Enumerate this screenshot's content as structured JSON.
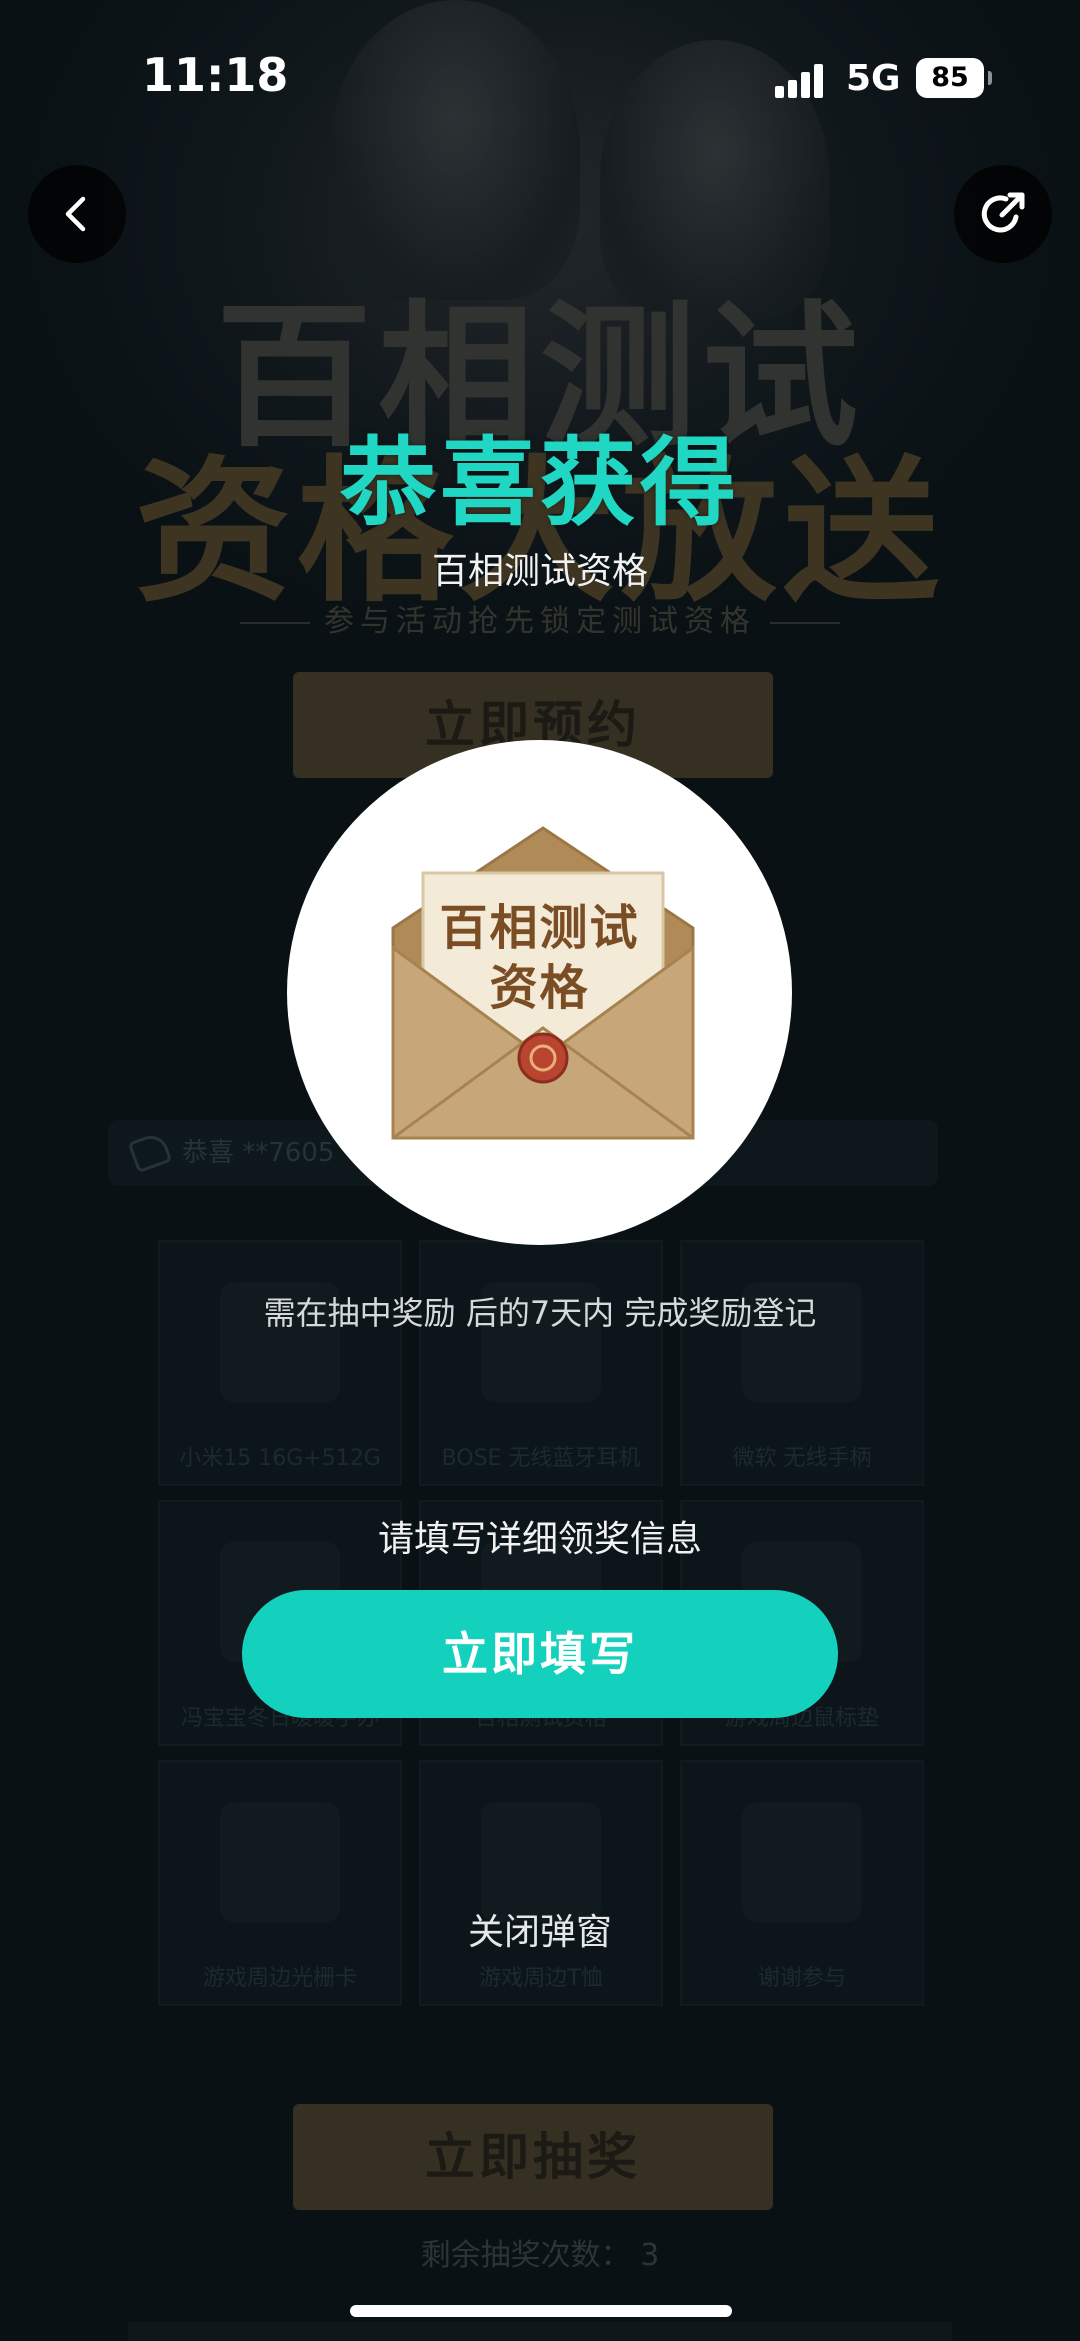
{
  "status_bar": {
    "time": "11:18",
    "network": "5G",
    "battery": "85"
  },
  "nav": {
    "back_icon": "chevron-left-icon",
    "share_icon": "share-icon"
  },
  "background": {
    "title_line1": "百相测试",
    "title_line2": "资格大放送",
    "subline": "参与活动抢先锁定测试资格",
    "reserve_button": "立即预约",
    "notice_prefix": "恭喜 **7605",
    "prizes": [
      {
        "label": "小米15 16G+512G"
      },
      {
        "label": "BOSE 无线蓝牙耳机"
      },
      {
        "label": "微软 无线手柄"
      },
      {
        "label": "冯宝宝冬日暖暖手办"
      },
      {
        "label": "百相测试资格"
      },
      {
        "label": "游戏周边鼠标垫"
      },
      {
        "label": "游戏周边光栅卡"
      },
      {
        "label": "游戏周边T恤"
      },
      {
        "label": "谢谢参与"
      }
    ],
    "draw_button": "立即抽奖",
    "remaining": "剩余抽奖次数： 3"
  },
  "popup": {
    "title": "恭喜获得",
    "subtitle": "百相测试资格",
    "prize_image_line1": "百相测试",
    "prize_image_line2": "资格",
    "notice": "需在抽中奖励 后的7天内 完成奖励登记",
    "fill_hint": "请填写详细领奖信息",
    "fill_button": "立即填写",
    "close": "关闭弹窗"
  },
  "colors": {
    "accent": "#13d1bd",
    "title_accent": "#20d7c4",
    "envelope": "#c7a77a"
  }
}
